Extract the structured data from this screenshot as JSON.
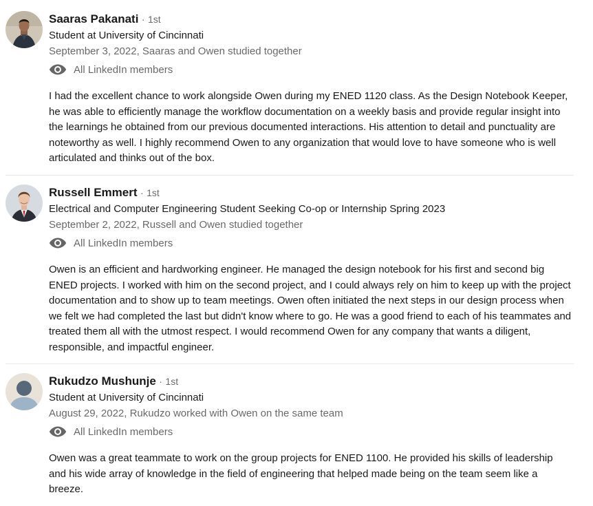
{
  "recommendations": [
    {
      "name": "Saaras Pakanati",
      "degree": "1st",
      "headline": "Student at University of Cincinnati",
      "meta": "September 3, 2022, Saaras and Owen studied together",
      "visibility": "All LinkedIn members",
      "text": "I had the excellent chance to work alongside Owen during my ENED 1120 class. As the Design Notebook Keeper, he was able to efficiently manage the workflow documentation on a weekly basis and provide regular insight into the learnings he obtained from our previous documented interactions. His attention to detail and punctuality are noteworthy as well. I highly recommend Owen to any organization that would love to have someone who is well articulated and thinks out of the box."
    },
    {
      "name": "Russell Emmert",
      "degree": "1st",
      "headline": "Electrical and Computer Engineering Student Seeking Co-op or Internship Spring 2023",
      "meta": "September 2, 2022, Russell and Owen studied together",
      "visibility": "All LinkedIn members",
      "text": "Owen is an efficient and hardworking engineer. He managed the design notebook for his first and second big ENED projects. I worked with him on the second project, and I could always rely on him to keep up with the project documentation and to show up to team meetings. Owen often initiated the next steps in our design process when we felt we had completed the last but didn't know where to go. He was a good friend to each of his teammates and treated them all with the utmost respect. I would recommend Owen for any company that wants a diligent, responsible, and impactful engineer."
    },
    {
      "name": "Rukudzo Mushunje",
      "degree": "1st",
      "headline": "Student at University of Cincinnati",
      "meta": "August 29, 2022, Rukudzo worked with Owen on the same team",
      "visibility": "All LinkedIn members",
      "text": "Owen was a great teammate to work on the group projects for ENED 1100. He provided his skills of leadership and his wide array of knowledge in the field of engineering that helped made being on the team seem like a breeze."
    }
  ],
  "separator": "·",
  "icons": {
    "visibility": "eye-icon"
  }
}
